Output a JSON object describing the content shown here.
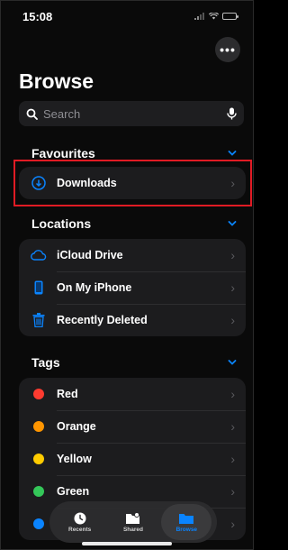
{
  "status": {
    "time": "15:08"
  },
  "title": "Browse",
  "search": {
    "placeholder": "Search"
  },
  "favourites": {
    "header": "Favourites",
    "items": [
      {
        "label": "Downloads",
        "icon": "download-icon"
      }
    ]
  },
  "locations": {
    "header": "Locations",
    "items": [
      {
        "label": "iCloud Drive",
        "icon": "cloud-icon"
      },
      {
        "label": "On My iPhone",
        "icon": "phone-icon"
      },
      {
        "label": "Recently Deleted",
        "icon": "trash-icon"
      }
    ]
  },
  "tags": {
    "header": "Tags",
    "items": [
      {
        "label": "Red",
        "color": "#ff3b30"
      },
      {
        "label": "Orange",
        "color": "#ff9500"
      },
      {
        "label": "Yellow",
        "color": "#ffcc00"
      },
      {
        "label": "Green",
        "color": "#34c759"
      },
      {
        "label": "",
        "color": "#0a84ff"
      }
    ]
  },
  "tab_bar": {
    "tabs": [
      {
        "label": "Recents",
        "icon": "clock-icon",
        "active": false
      },
      {
        "label": "Shared",
        "icon": "shared-folder-icon",
        "active": false
      },
      {
        "label": "Browse",
        "icon": "folder-icon",
        "active": true
      }
    ]
  },
  "colors": {
    "accent": "#0a84ff",
    "highlight": "#e01b24",
    "background": "#0a0a0a",
    "card": "#1c1c1e"
  }
}
